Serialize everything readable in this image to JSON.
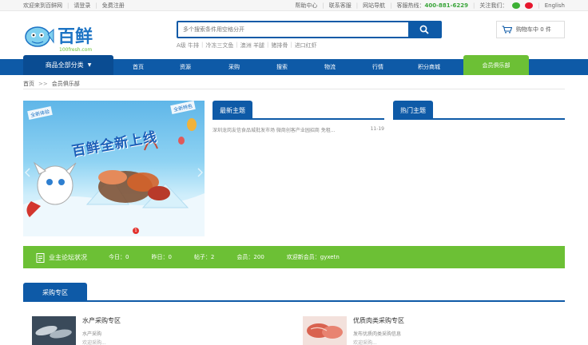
{
  "topbar": {
    "welcome": "欢迎来到百鲜网",
    "login": "请登录",
    "register": "免费注册",
    "help": "帮助中心",
    "contact": "联系客服",
    "sitemap": "网站导航",
    "hotline_label": "客服热线：",
    "hotline": "400-881-6229",
    "follow": "关注我们：",
    "english": "English"
  },
  "logo": {
    "cn": "百鲜",
    "url_text": "100fresh.com"
  },
  "search": {
    "placeholder": "多个搜索条件用空格分开",
    "hotwords": [
      "A级 牛排",
      "冷冻三文鱼",
      "澳洲 羊腿",
      "猪排骨",
      "进口红虾"
    ]
  },
  "cart": {
    "label": "购物车中 0 件"
  },
  "nav": {
    "category": "商品全部分类",
    "items": [
      "首页",
      "资源",
      "采购",
      "搜索",
      "物流",
      "行情",
      "积分商城"
    ],
    "club": "会员俱乐部"
  },
  "breadcrumb": {
    "home": "首页",
    "sep": ">>",
    "current": "会员俱乐部"
  },
  "banner": {
    "title": "百鲜全新上线",
    "tag_left": "全新体验",
    "tag_right": "全新特色",
    "page": "1"
  },
  "latest": {
    "title": "最新主题",
    "rows": [
      {
        "text": "深圳龙岗友信食品城批发市场 微商创客产业园招商 免租...",
        "date": "11-19"
      }
    ]
  },
  "hot": {
    "title": "热门主题"
  },
  "forum": {
    "label": "业主论坛状况",
    "today": "今日：0",
    "yesterday": "昨日：0",
    "posts": "帖子：2",
    "members": "会员：200",
    "welcome": "欢迎新会员：gyxetn"
  },
  "purchase": {
    "title": "采购专区",
    "cards": [
      {
        "name": "水产采购专区",
        "desc": "水产采购",
        "more": "欢迎采购..."
      },
      {
        "name": "优质肉类采购专区",
        "desc": "发布优质肉类采购信息",
        "more": "欢迎采购..."
      }
    ]
  },
  "colors": {
    "brand_blue": "#0e5aa7",
    "green": "#6cc035",
    "hotline_green": "#3aa53a"
  }
}
